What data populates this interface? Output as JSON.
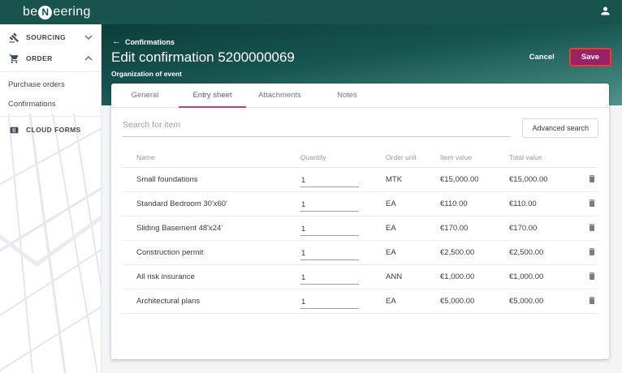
{
  "topbar": {
    "logo": {
      "pre": "be",
      "circled": "N",
      "post": "eering"
    }
  },
  "sidebar": {
    "items": [
      {
        "label": "SOURCING",
        "icon": "gavel-icon",
        "chevron": "down"
      },
      {
        "label": "ORDER",
        "icon": "cart-icon",
        "chevron": "up"
      },
      {
        "label": "Purchase orders"
      },
      {
        "label": "Confirmations"
      },
      {
        "label": "CLOUD FORMS",
        "icon": "form-icon"
      }
    ]
  },
  "header": {
    "back_arrow": "←",
    "breadcrumb": "Confirmations",
    "title": "Edit confirmation 5200000069",
    "subtitle": "Organization of event",
    "cancel_label": "Cancel",
    "save_label": "Save"
  },
  "tabs": [
    {
      "label": "General",
      "active": false
    },
    {
      "label": "Entry sheet",
      "active": true
    },
    {
      "label": "Attachments",
      "active": false
    },
    {
      "label": "Notes",
      "active": false
    }
  ],
  "search": {
    "placeholder": "Search for item",
    "advanced_label": "Advanced search"
  },
  "table": {
    "headers": [
      "Name",
      "Quantity",
      "Order unit",
      "Item value",
      "Total value"
    ],
    "rows": [
      {
        "name": "Small foundations",
        "qty": "1",
        "unit": "MTK",
        "item_value": "€15,000.00",
        "total_value": "€15,000.00"
      },
      {
        "name": "Standard Bedroom 30'x60'",
        "qty": "1",
        "unit": "EA",
        "item_value": "€110.00",
        "total_value": "€110.00"
      },
      {
        "name": "Sliding Basement 48'x24'",
        "qty": "1",
        "unit": "EA",
        "item_value": "€170.00",
        "total_value": "€170.00"
      },
      {
        "name": "Construction permit",
        "qty": "1",
        "unit": "EA",
        "item_value": "€2,500.00",
        "total_value": "€2,500.00"
      },
      {
        "name": "All risk insurance",
        "qty": "1",
        "unit": "ANN",
        "item_value": "€1,000.00",
        "total_value": "€1,000.00"
      },
      {
        "name": "Architectural plans",
        "qty": "1",
        "unit": "EA",
        "item_value": "€5,000.00",
        "total_value": "€5,000.00"
      }
    ]
  },
  "colors": {
    "topbar_teal": "#18534e",
    "hero_gradient_top": "#0c3e3a",
    "hero_gradient_bottom": "#4e958b",
    "save_magenta": "#9a2166",
    "save_border_red": "#f2392c",
    "tab_underline_magenta": "#bf3d92"
  }
}
